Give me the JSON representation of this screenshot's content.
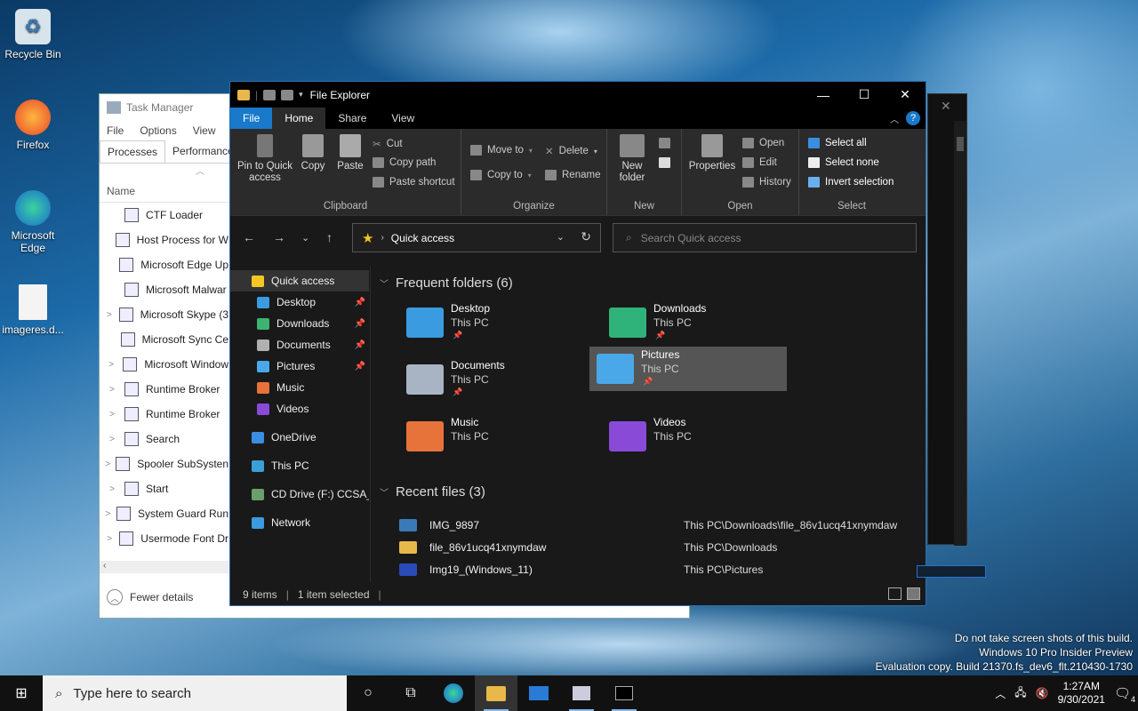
{
  "desktop": {
    "icons": [
      {
        "label": "Recycle Bin"
      },
      {
        "label": "Firefox"
      },
      {
        "label": "Microsoft Edge"
      },
      {
        "label": "imageres.d..."
      }
    ]
  },
  "task_manager": {
    "title": "Task Manager",
    "menu": [
      "File",
      "Options",
      "View"
    ],
    "tabs": [
      "Processes",
      "Performance"
    ],
    "column_name": "Name",
    "processes": [
      {
        "name": "CTF Loader",
        "expand": ""
      },
      {
        "name": "Host Process for W",
        "expand": ""
      },
      {
        "name": "Microsoft Edge Up",
        "expand": ""
      },
      {
        "name": "Microsoft Malwar",
        "expand": ""
      },
      {
        "name": "Microsoft Skype (3",
        "expand": ">"
      },
      {
        "name": "Microsoft Sync Ce",
        "expand": ""
      },
      {
        "name": "Microsoft Window",
        "expand": ">"
      },
      {
        "name": "Runtime Broker",
        "expand": ">"
      },
      {
        "name": "Runtime Broker",
        "expand": ">"
      },
      {
        "name": "Search",
        "expand": ">"
      },
      {
        "name": "Spooler SubSysten",
        "expand": ">"
      },
      {
        "name": "Start",
        "expand": ">"
      },
      {
        "name": "System Guard Run",
        "expand": ">"
      },
      {
        "name": "Usermode Font Dr",
        "expand": ">"
      }
    ],
    "fewer_details": "Fewer details"
  },
  "explorer": {
    "title": "File Explorer",
    "tabs": [
      "File",
      "Home",
      "Share",
      "View"
    ],
    "ribbon": {
      "clipboard": {
        "label": "Clipboard",
        "pin": "Pin to Quick access",
        "copy": "Copy",
        "paste": "Paste",
        "cut": "Cut",
        "copy_path": "Copy path",
        "paste_shortcut": "Paste shortcut"
      },
      "organize": {
        "label": "Organize",
        "move_to": "Move to",
        "copy_to": "Copy to",
        "delete": "Delete",
        "rename": "Rename"
      },
      "new": {
        "label": "New",
        "new_folder": "New folder"
      },
      "open": {
        "label": "Open",
        "properties": "Properties",
        "open": "Open",
        "edit": "Edit",
        "history": "History"
      },
      "select": {
        "label": "Select",
        "select_all": "Select all",
        "select_none": "Select none",
        "invert": "Invert selection"
      }
    },
    "address": "Quick access",
    "search_placeholder": "Search Quick access",
    "nav": [
      {
        "label": "Quick access",
        "pinned": false,
        "color": "#f3c622"
      },
      {
        "label": "Desktop",
        "pinned": true,
        "color": "#3a9be0"
      },
      {
        "label": "Downloads",
        "pinned": true,
        "color": "#3cb371"
      },
      {
        "label": "Documents",
        "pinned": true,
        "color": "#b0b0b0"
      },
      {
        "label": "Pictures",
        "pinned": true,
        "color": "#4aa8e8"
      },
      {
        "label": "Music",
        "pinned": false,
        "color": "#e8733a"
      },
      {
        "label": "Videos",
        "pinned": false,
        "color": "#8a4ad8"
      },
      {
        "label": "OneDrive",
        "pinned": false,
        "color": "#3a8ee0"
      },
      {
        "label": "This PC",
        "pinned": false,
        "color": "#3aa0d8"
      },
      {
        "label": "CD Drive (F:) CCSA_X",
        "pinned": false,
        "color": "#6aa06a"
      },
      {
        "label": "Network",
        "pinned": false,
        "color": "#3a9be0"
      }
    ],
    "frequent_header": "Frequent folders (6)",
    "folders": [
      {
        "name": "Desktop",
        "loc": "This PC",
        "pinned": true,
        "color": "#3a9be0"
      },
      {
        "name": "Downloads",
        "loc": "This PC",
        "pinned": true,
        "color": "#2fb37a"
      },
      {
        "name": "Documents",
        "loc": "This PC",
        "pinned": true,
        "color": "#a8b4c4"
      },
      {
        "name": "Pictures",
        "loc": "This PC",
        "pinned": true,
        "color": "#4aa8e8"
      },
      {
        "name": "Music",
        "loc": "This PC",
        "pinned": false,
        "color": "#e8733a"
      },
      {
        "name": "Videos",
        "loc": "This PC",
        "pinned": false,
        "color": "#8a4ad8"
      }
    ],
    "recent_header": "Recent files (3)",
    "recent": [
      {
        "name": "IMG_9897",
        "path": "This PC\\Downloads\\file_86v1ucq41xnymdaw",
        "color": "#3a7ab8"
      },
      {
        "name": "file_86v1ucq41xnymdaw",
        "path": "This PC\\Downloads",
        "color": "#e8b84a"
      },
      {
        "name": "Img19_(Windows_11)",
        "path": "This PC\\Pictures",
        "color": "#2a4ab8"
      }
    ],
    "status_items": "9 items",
    "status_selected": "1 item selected"
  },
  "watermark": [
    "Do not take screen shots of this build.",
    "Windows 10 Pro Insider Preview",
    "Evaluation copy. Build 21370.fs_dev6_flt.210430-1730"
  ],
  "taskbar": {
    "search_placeholder": "Type here to search",
    "time": "1:27AM",
    "date": "9/30/2021",
    "notification_count": "4"
  }
}
